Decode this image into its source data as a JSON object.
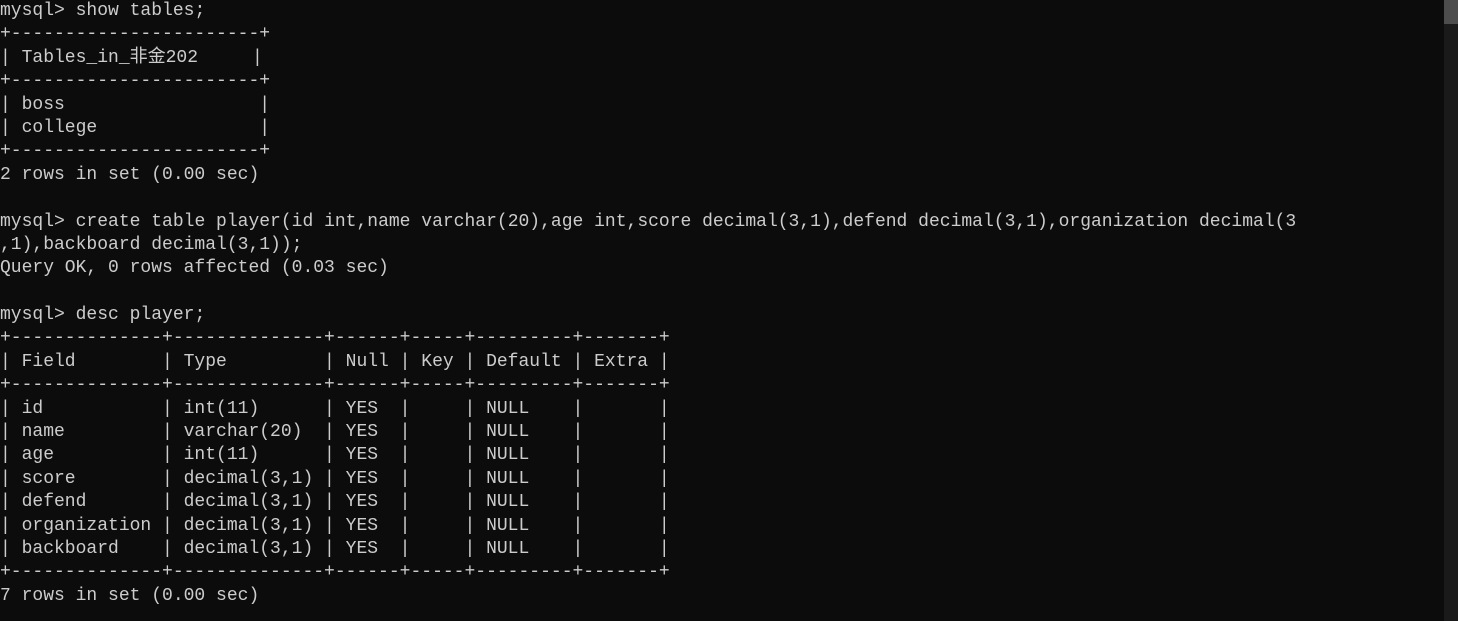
{
  "prompt": "mysql>",
  "cmd1": "show tables;",
  "tables_result": {
    "border_top": "+-----------------------+",
    "header_line": "| Tables_in_非金202     |",
    "border_mid": "+-----------------------+",
    "rows": [
      "| boss                  |",
      "| college               |"
    ],
    "border_bot": "+-----------------------+",
    "summary": "2 rows in set (0.00 sec)"
  },
  "cmd2_line1": "create table player(id int,name varchar(20),age int,score decimal(3,1),defend decimal(3,1),organization decimal(3",
  "cmd2_line2": ",1),backboard decimal(3,1));",
  "cmd2_result": "Query OK, 0 rows affected (0.03 sec)",
  "cmd3": "desc player;",
  "desc_result": {
    "border": "+--------------+--------------+------+-----+---------+-------+",
    "header": "| Field        | Type         | Null | Key | Default | Extra |",
    "rows": [
      "| id           | int(11)      | YES  |     | NULL    |       |",
      "| name         | varchar(20)  | YES  |     | NULL    |       |",
      "| age          | int(11)      | YES  |     | NULL    |       |",
      "| score        | decimal(3,1) | YES  |     | NULL    |       |",
      "| defend       | decimal(3,1) | YES  |     | NULL    |       |",
      "| organization | decimal(3,1) | YES  |     | NULL    |       |",
      "| backboard    | decimal(3,1) | YES  |     | NULL    |       |"
    ],
    "summary": "7 rows in set (0.00 sec)"
  }
}
